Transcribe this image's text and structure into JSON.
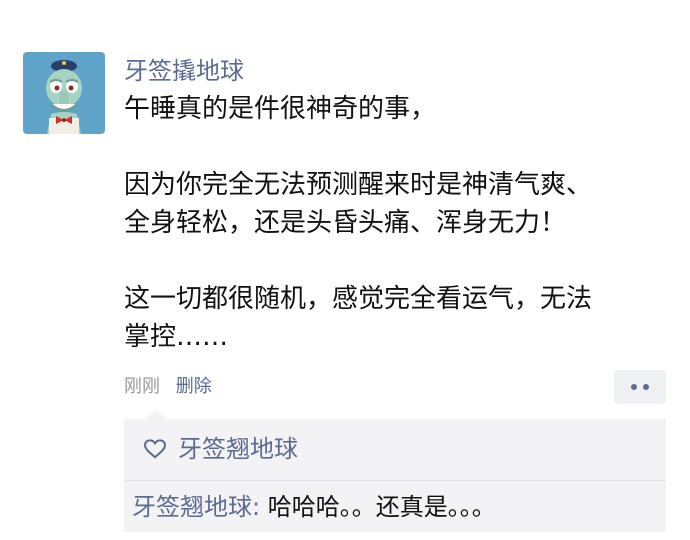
{
  "post": {
    "author": "牙签撬地球",
    "paragraphs": [
      "午睡真的是件很神奇的事，",
      "因为你完全无法预测醒来时是神清气爽、\n全身轻松，还是头昏头痛、浑身无力！",
      "这一切都很随机，感觉完全看运气，无法\n掌控……"
    ],
    "time": "刚刚",
    "delete_label": "删除"
  },
  "interactions": {
    "likes": [
      "牙签翘地球"
    ],
    "comments": [
      {
        "author": "牙签翘地球",
        "separator": ": ",
        "text": "哈哈哈。。还真是。。。"
      }
    ]
  },
  "icons": {
    "avatar": "squidward-avatar",
    "like": "heart-outline-icon",
    "more": "more-dots-icon"
  },
  "colors": {
    "name_blue": "#5b6b93",
    "text": "#111111",
    "time_gray": "#9a9a9a",
    "comment_bg": "#f3f3f5"
  }
}
